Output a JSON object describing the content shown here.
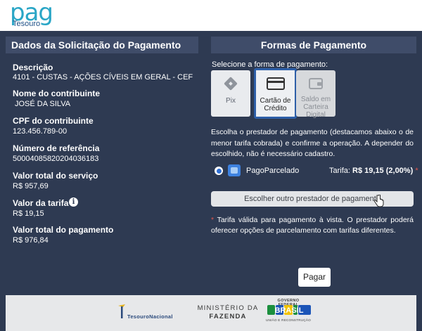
{
  "brand": {
    "logo_text": "pag",
    "logo_sub": "Tesouro"
  },
  "left_panel": {
    "title": "Dados da Solicitação do Pagamento",
    "fields": [
      {
        "label": "Descrição",
        "value": "4101 - CUSTAS - AÇÕES CÍVEIS EM GERAL - CEF"
      },
      {
        "label": "Nome do contribuinte",
        "value": "JOSÉ DA SILVA"
      },
      {
        "label": "CPF do contribuinte",
        "value": "123.456.789-00"
      },
      {
        "label": "Número de referência",
        "value": "50004085820204036183"
      },
      {
        "label": "Valor total do serviço",
        "value": "R$  957,69"
      },
      {
        "label": "Valor da tarifa",
        "value": "R$  19,15"
      },
      {
        "label": "Valor total do pagamento",
        "value": "R$  976,84"
      }
    ]
  },
  "right_panel": {
    "title": "Formas de Pagamento",
    "select_label": "Selecione a forma de pagamento:",
    "methods": [
      {
        "label_1": "Pix",
        "label_2": "",
        "label_3": "",
        "state": "available"
      },
      {
        "label_1": "Cartão de",
        "label_2": "Crédito",
        "label_3": "",
        "state": "selected"
      },
      {
        "label_1": "Saldo em",
        "label_2": "Carteira",
        "label_3": "Digital",
        "state": "disabled"
      }
    ],
    "description": "Escolha o prestador de pagamento (destacamos abaixo o de menor tarifa cobrada) e confirme a operação. A depender do escolhido, não é necessário cadastro.",
    "provider": {
      "name": "PagoParcelado",
      "tariff_label": "Tarifa:",
      "tariff_value": "R$  19,15 (2,00%)",
      "asterisk": "*"
    },
    "choose_button": "Escolher outro prestador de pagamento",
    "note_asterisk": "*",
    "note": "Tarifa válida para pagamento à vista. O prestador poderá oferecer opções de parcelamento com tarifas diferentes.",
    "pay_button": "Pagar"
  },
  "footer": {
    "tesouro": "TesouroNacional",
    "ministerio_1": "MINISTÉRIO DA",
    "ministerio_2": "FAZENDA",
    "governo_1": "GOVERNO FEDERAL",
    "governo_word": "BRASIL",
    "governo_2": "UNIÃO E RECONSTRUÇÃO"
  },
  "colors": {
    "background": "#2e3a52",
    "band": "#3f4c69",
    "accent": "#2e5fa8",
    "radio": "#2f6fd4",
    "asterisk": "#e2574c"
  }
}
